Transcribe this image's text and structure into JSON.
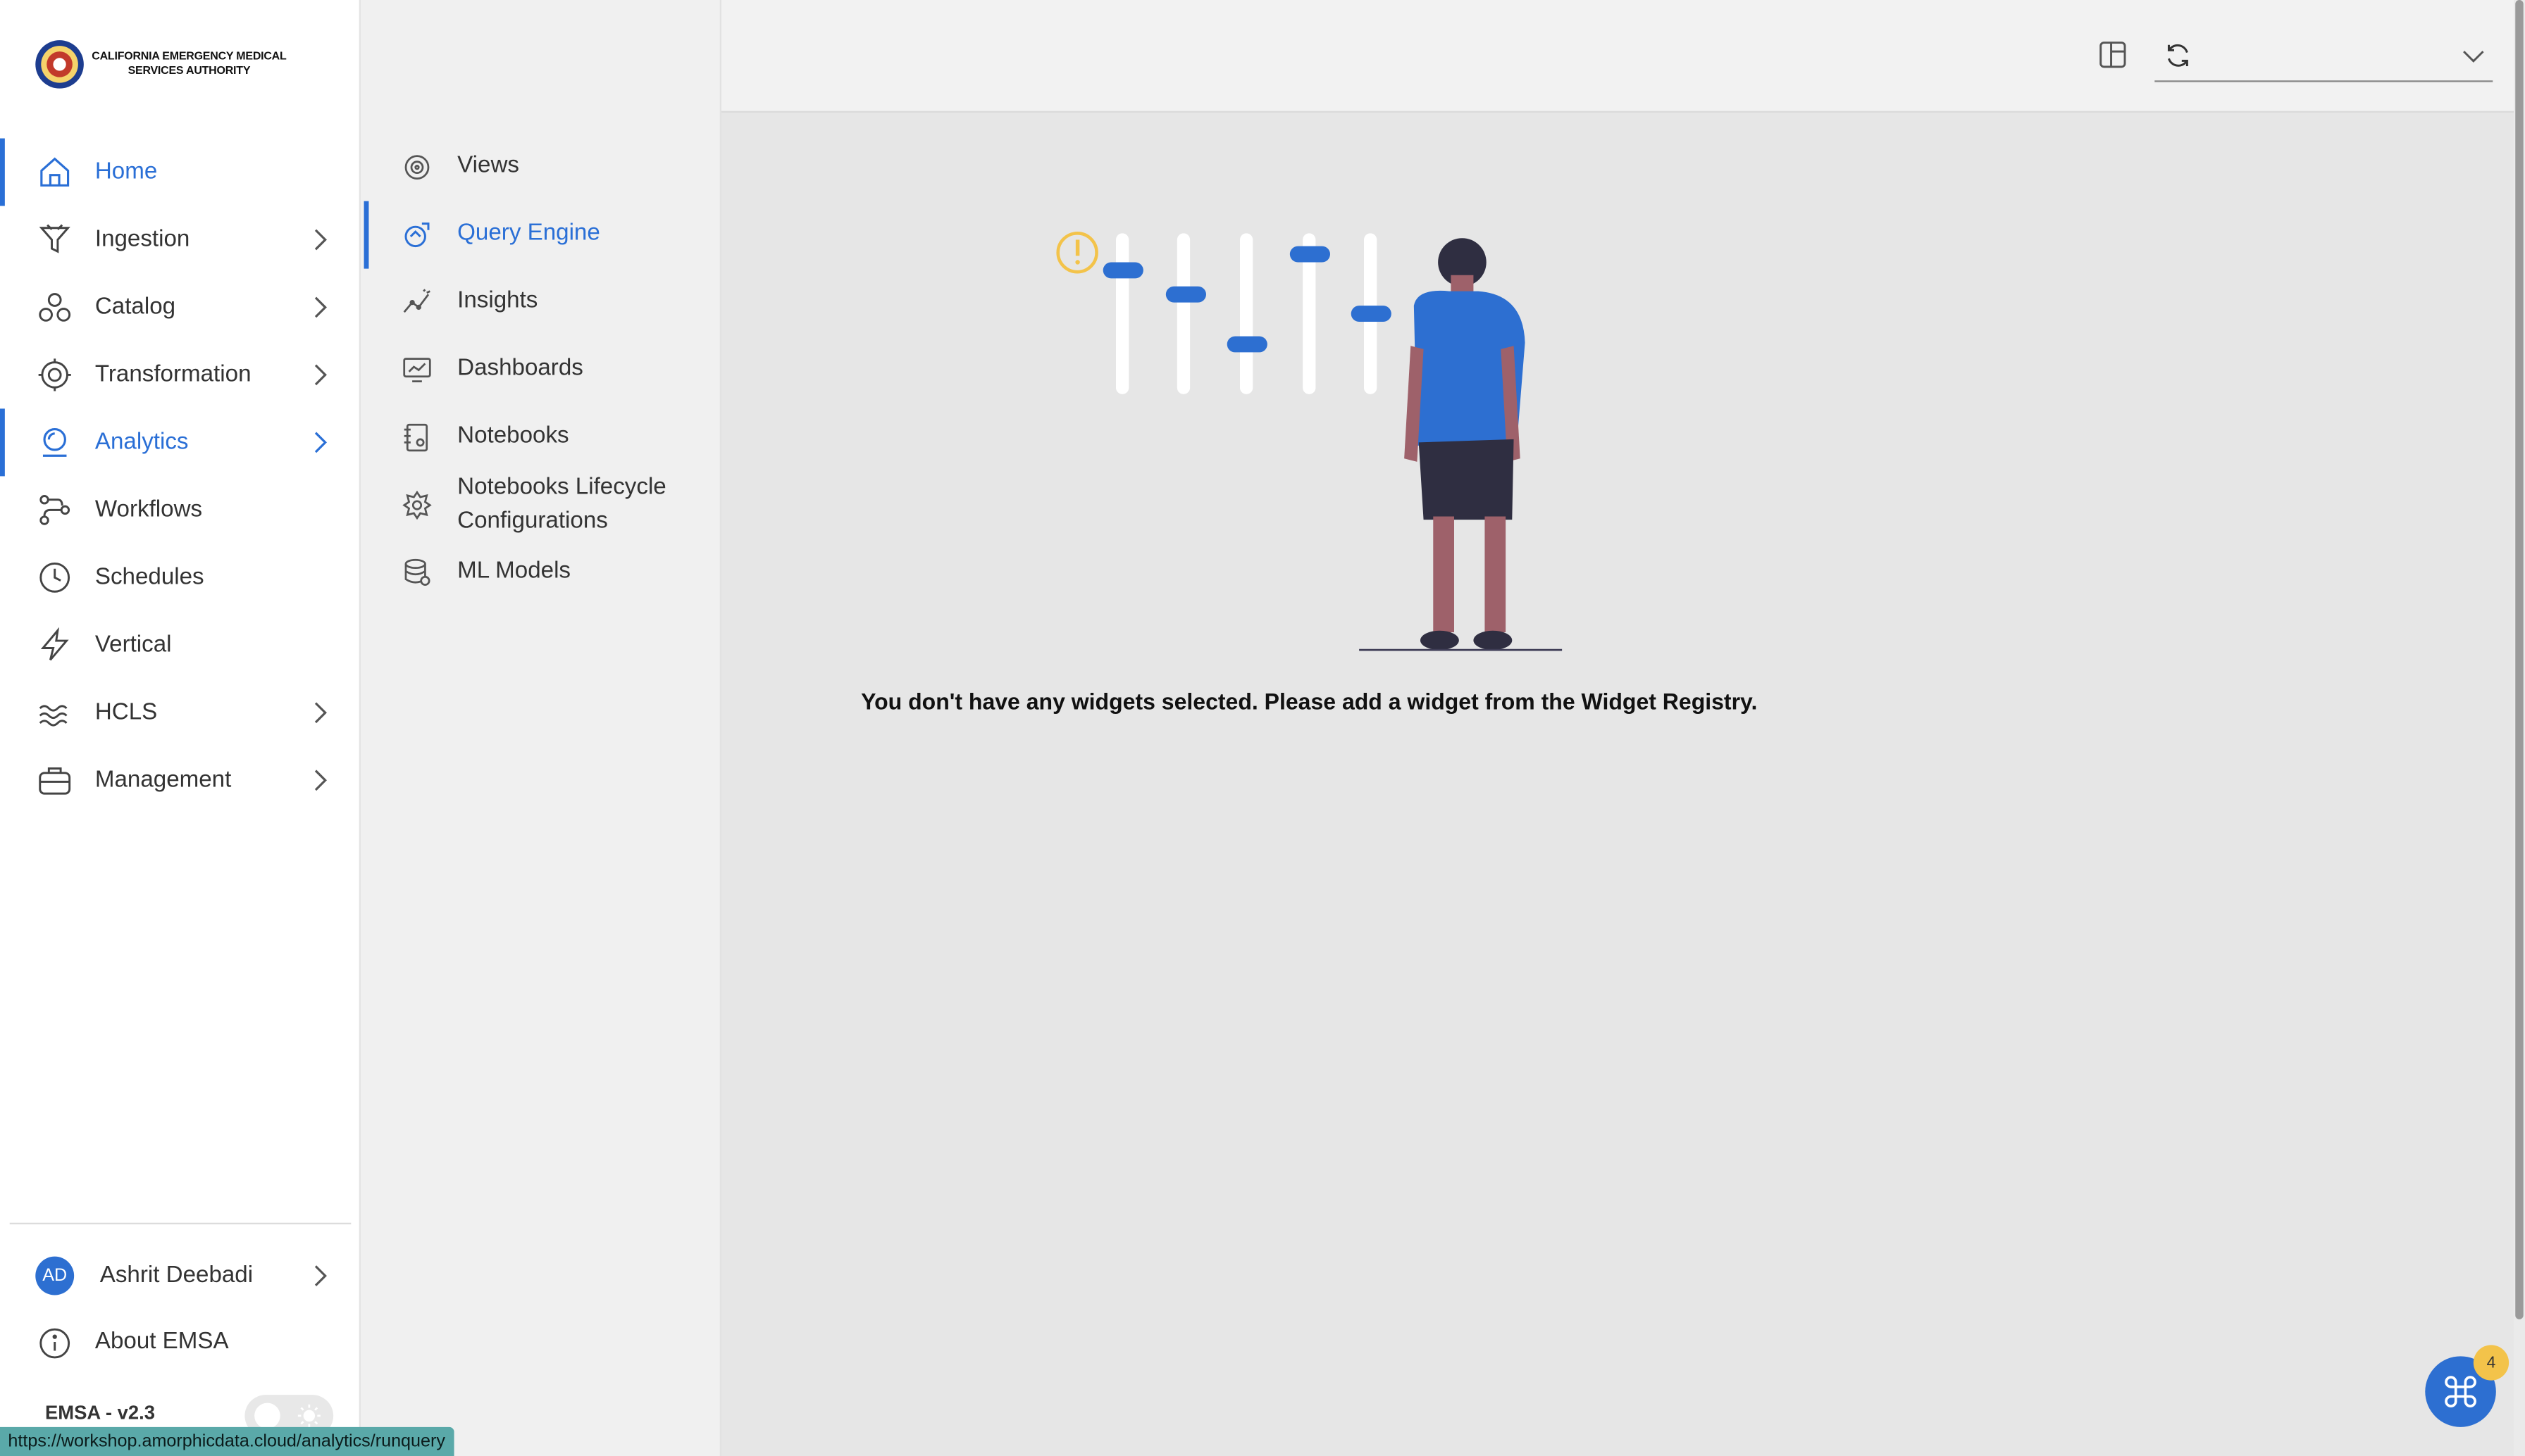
{
  "branding": {
    "org_line1": "CALIFORNIA EMERGENCY MEDICAL",
    "org_line2": "SERVICES AUTHORITY"
  },
  "sidebar": {
    "items": [
      {
        "label": "Home",
        "icon": "home-icon",
        "active": true,
        "expandable": false
      },
      {
        "label": "Ingestion",
        "icon": "funnel-icon",
        "active": false,
        "expandable": true
      },
      {
        "label": "Catalog",
        "icon": "catalog-icon",
        "active": false,
        "expandable": true
      },
      {
        "label": "Transformation",
        "icon": "gear-icon",
        "active": false,
        "expandable": true
      },
      {
        "label": "Analytics",
        "icon": "analytics-icon",
        "active": true,
        "expandable": true
      },
      {
        "label": "Workflows",
        "icon": "workflow-icon",
        "active": false,
        "expandable": false
      },
      {
        "label": "Schedules",
        "icon": "clock-icon",
        "active": false,
        "expandable": false
      },
      {
        "label": "Vertical",
        "icon": "bolt-icon",
        "active": false,
        "expandable": false
      },
      {
        "label": "HCLS",
        "icon": "waves-icon",
        "active": false,
        "expandable": true
      },
      {
        "label": "Management",
        "icon": "briefcase-icon",
        "active": false,
        "expandable": true
      }
    ],
    "user": {
      "initials": "AD",
      "name": "Ashrit Deebadi"
    },
    "about_label": "About EMSA",
    "version": "EMSA - v2.3"
  },
  "subnav": {
    "items": [
      {
        "label": "Views",
        "icon": "views-icon",
        "active": false
      },
      {
        "label": "Query Engine",
        "icon": "query-icon",
        "active": true
      },
      {
        "label": "Insights",
        "icon": "insights-icon",
        "active": false
      },
      {
        "label": "Dashboards",
        "icon": "dashboard-icon",
        "active": false
      },
      {
        "label": "Notebooks",
        "icon": "notebook-icon",
        "active": false
      },
      {
        "label_line1": "Notebooks Lifecycle",
        "label_line2": "Configurations",
        "icon": "lifecycle-icon",
        "active": false
      },
      {
        "label": "ML Models",
        "icon": "ml-models-icon",
        "active": false
      }
    ]
  },
  "main": {
    "empty_message": "You don't have any widgets selected. Please add a widget from the Widget Registry.",
    "fab_badge": "4"
  },
  "status_bar": {
    "url": "https://workshop.amorphicdata.cloud/analytics/runquery"
  },
  "colors": {
    "accent": "#2a6fd6",
    "badge": "#f3c34a",
    "warning": "#f3c34a"
  }
}
